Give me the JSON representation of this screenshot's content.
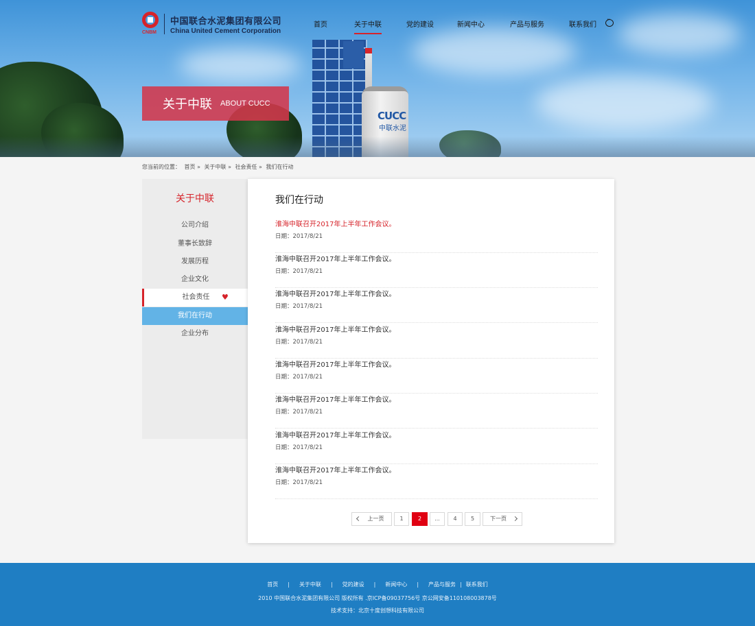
{
  "header": {
    "logo_cn": "中国联合水泥集团有限公司",
    "logo_en": "China United Cement Corporation",
    "logo_abbr": "CNBM",
    "nav": [
      {
        "label": "首页"
      },
      {
        "label": "关于中联",
        "active": true
      },
      {
        "label": "党的建设"
      },
      {
        "label": "新闻中心"
      },
      {
        "label": "产品与服务"
      },
      {
        "label": "联系我们"
      }
    ],
    "chat_icon": "chat-bubble-icon"
  },
  "banner": {
    "title_cn": "关于中联",
    "title_en": "ABOUT CUCC",
    "silo_text": "CUCC",
    "silo_sub": "中联水泥"
  },
  "breadcrumb": {
    "prefix": "您当前的位置：",
    "items": [
      "首页 »",
      "关于中联 »",
      "社会责任 »",
      "我们在行动"
    ]
  },
  "sidebar": {
    "title": "关于中联",
    "items": [
      {
        "label": "公司介绍"
      },
      {
        "label": "董事长致辞"
      },
      {
        "label": "发展历程"
      },
      {
        "label": "企业文化"
      },
      {
        "label": "社会责任",
        "state": "open"
      },
      {
        "label": "我们在行动",
        "state": "current"
      },
      {
        "label": "企业分布"
      }
    ],
    "open_icon": "heart-icon"
  },
  "content": {
    "title": "我们在行动",
    "news": [
      {
        "title": "淮海中联召开2017年上半年工作会议。",
        "date": "日期：2017/8/21",
        "highlight": true
      },
      {
        "title": "淮海中联召开2017年上半年工作会议。",
        "date": "日期：2017/8/21"
      },
      {
        "title": "淮海中联召开2017年上半年工作会议。",
        "date": "日期：2017/8/21"
      },
      {
        "title": "淮海中联召开2017年上半年工作会议。",
        "date": "日期：2017/8/21"
      },
      {
        "title": "淮海中联召开2017年上半年工作会议。",
        "date": "日期：2017/8/21"
      },
      {
        "title": "淮海中联召开2017年上半年工作会议。",
        "date": "日期：2017/8/21"
      },
      {
        "title": "淮海中联召开2017年上半年工作会议。",
        "date": "日期：2017/8/21"
      },
      {
        "title": "淮海中联召开2017年上半年工作会议。",
        "date": "日期：2017/8/21"
      }
    ],
    "pagination": {
      "prev": "上一页",
      "next": "下一页",
      "pages": [
        "1",
        "2",
        "...",
        "4",
        "5"
      ],
      "current": "2"
    }
  },
  "footer": {
    "nav": [
      "首页",
      "关于中联",
      "党的建设",
      "新闻中心",
      "产品与服务",
      "联系我们"
    ],
    "separator": "|",
    "copyright": "2010 中国联合水泥集团有限公司 版权所有 .京ICP备09037756号 京公网安备110108003878号",
    "tech": "技术支持：北京十度创想科技有限公司"
  },
  "colors": {
    "brand_red": "#d6232a",
    "sidebar_current": "#62b3e6",
    "footer_blue": "#1f7ec3",
    "pager_active": "#e00012"
  }
}
